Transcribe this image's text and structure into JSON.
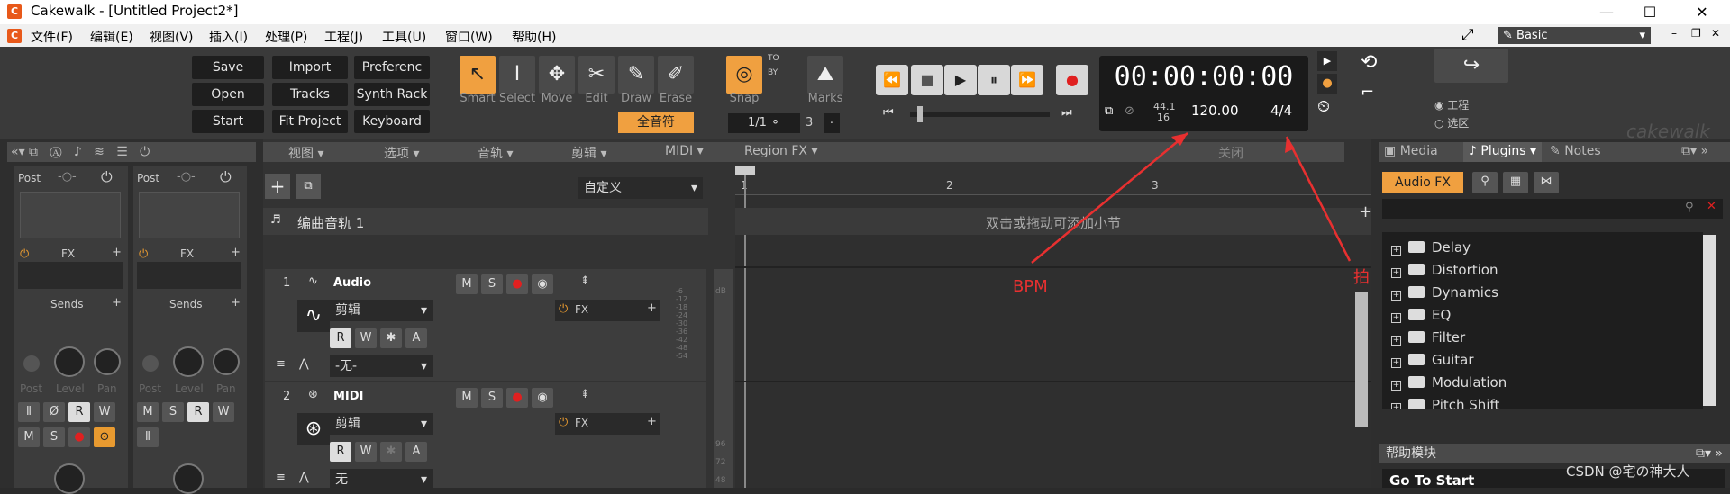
{
  "window": {
    "title": "Cakewalk - [Untitled Project2*]",
    "min": "—",
    "max": "☐",
    "close": "✕"
  },
  "menu": [
    "文件(F)",
    "编辑(E)",
    "视图(V)",
    "插入(I)",
    "处理(P)",
    "工程(J)",
    "工具(U)",
    "窗口(W)",
    "帮助(H)"
  ],
  "workspace": {
    "label": "Basic"
  },
  "buttons": {
    "save": "Save",
    "import": "Import",
    "prefs": "Preferenc ...",
    "open": "Open",
    "tracks": "Tracks",
    "synthrack": "Synth Rack",
    "startscreen": "Start Scre...",
    "fitproject": "Fit Project",
    "keyboard": "Keyboard"
  },
  "tools": [
    "Smart",
    "Select",
    "Move",
    "Edit",
    "Draw",
    "Erase"
  ],
  "snap": {
    "label": "Snap",
    "value": "全音符",
    "to": "TO",
    "by": "BY",
    "frac": "1/1",
    "num": "3",
    "dot": "."
  },
  "marks": "Marks",
  "transport": {
    "time": "00:00:00:00",
    "rate_top": "44.1",
    "rate_bottom": "16",
    "bpm": "120.00",
    "meter": "4/4"
  },
  "selection": {
    "project": "工程",
    "selection": "选区"
  },
  "brand": "cakewalk",
  "trackview_menu": [
    "视图",
    "选项",
    "音轨",
    "剪辑",
    "MIDI",
    "Region FX"
  ],
  "close_label": "关闭",
  "custom": "自定义",
  "ruler": [
    "1",
    "2",
    "3"
  ],
  "arranger": {
    "track": "编曲音轨 1",
    "hint": "双击或拖动可添加小节"
  },
  "tracks": [
    {
      "num": "1",
      "name": "Audio",
      "clip": "剪辑",
      "input": "-无-"
    },
    {
      "num": "2",
      "name": "MIDI",
      "clip": "剪辑",
      "input": "无"
    }
  ],
  "track_fx": "FX",
  "db": [
    "-6",
    "-12",
    "-18",
    "-24",
    "-30",
    "-36",
    "-42",
    "-48",
    "-54"
  ],
  "db_label": "dB",
  "meter2": [
    "96",
    "72",
    "48"
  ],
  "trackbtns": {
    "m": "M",
    "s": "S",
    "r": "R",
    "w": "W",
    "a": "A"
  },
  "console": {
    "post": "Post",
    "fx": "FX",
    "sends": "Sends",
    "labels": [
      "Post",
      "Level",
      "Pan"
    ]
  },
  "browser": {
    "tabs": [
      "Media",
      "Plugins",
      "Notes"
    ],
    "audiofx": "Audio FX",
    "items": [
      "Delay",
      "Distortion",
      "Dynamics",
      "EQ",
      "Filter",
      "Guitar",
      "Modulation",
      "Pitch Shift"
    ]
  },
  "help": {
    "title": "帮助模块",
    "goto": "Go To Start"
  },
  "annotations": {
    "bpm": "BPM",
    "beat": "拍"
  },
  "watermark": "CSDN @宅の神大人"
}
